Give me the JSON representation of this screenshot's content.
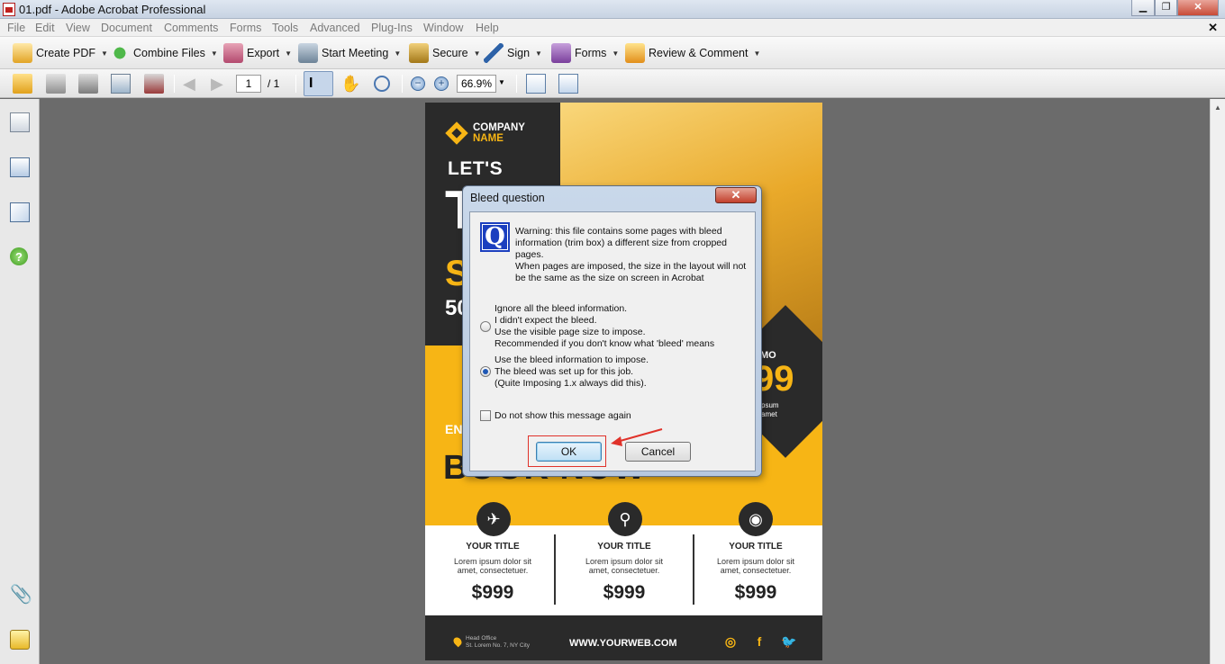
{
  "window": {
    "title": "01.pdf - Adobe Acrobat Professional"
  },
  "menu": [
    "File",
    "Edit",
    "View",
    "Document",
    "Comments",
    "Forms",
    "Tools",
    "Advanced",
    "Plug-Ins",
    "Window",
    "Help"
  ],
  "tasks": [
    {
      "label": "Create PDF",
      "icon": "create-pdf-icon"
    },
    {
      "label": "Combine Files",
      "icon": "combine-files-icon"
    },
    {
      "label": "Export",
      "icon": "export-icon"
    },
    {
      "label": "Start Meeting",
      "icon": "meeting-icon"
    },
    {
      "label": "Secure",
      "icon": "lock-icon"
    },
    {
      "label": "Sign",
      "icon": "pen-icon"
    },
    {
      "label": "Forms",
      "icon": "forms-icon"
    },
    {
      "label": "Review & Comment",
      "icon": "comment-icon"
    }
  ],
  "nav": {
    "page_current": "1",
    "page_total": "/ 1",
    "zoom": "66.9%"
  },
  "flyer": {
    "company_line1": "COMPANY",
    "company_line2": "NAME",
    "lets": "LET'S",
    "t_big": "T",
    "s_big": "S",
    "num_50": "50",
    "en": "EN",
    "book_now": "BOOK NOW",
    "promo": "MO",
    "promo_price": "99",
    "promo_small1": "psum",
    "promo_small2": "amet",
    "columns": [
      {
        "title": "YOUR TITLE",
        "body1": "Lorem ipsum dolor sit",
        "body2": "amet, consectetuer.",
        "price": "$999",
        "icon": "airplane-icon",
        "glyph": "✈"
      },
      {
        "title": "YOUR TITLE",
        "body1": "Lorem ipsum dolor sit",
        "body2": "amet, consectetuer.",
        "price": "$999",
        "icon": "location-pin-icon",
        "glyph": "⚲"
      },
      {
        "title": "YOUR TITLE",
        "body1": "Lorem ipsum dolor sit",
        "body2": "amet, consectetuer.",
        "price": "$999",
        "icon": "camera-icon",
        "glyph": "◉"
      }
    ],
    "office_label": "Head Office",
    "office_address": "St. Lorem No. 7, NY City",
    "website": "WWW.YOURWEB.COM",
    "social": [
      {
        "icon": "instagram-icon",
        "glyph": "◎"
      },
      {
        "icon": "facebook-icon",
        "glyph": "f"
      },
      {
        "icon": "twitter-icon",
        "glyph": "🐦"
      }
    ]
  },
  "dialog": {
    "title": "Bleed question",
    "warning_lines": [
      "Warning: this file contains some pages with bleed",
      "information (trim box) a different size from cropped",
      "pages.",
      "When pages are imposed, the size in the layout will not",
      "be the same as the size on screen in Acrobat"
    ],
    "option1_lines": [
      "Ignore all the bleed information.",
      "I didn't expect the bleed.",
      "Use the visible page size to impose.",
      "Recommended if you don't know what 'bleed' means"
    ],
    "option2_lines": [
      "Use the bleed information to impose.",
      "The bleed was set up for this job.",
      "(Quite Imposing 1.x always did this)."
    ],
    "selected_option": 2,
    "dont_show_label": "Do not show this message again",
    "dont_show_checked": false,
    "ok_label": "OK",
    "cancel_label": "Cancel"
  },
  "colors": {
    "accent": "#f7b515",
    "annotation_red": "#e0322a"
  }
}
